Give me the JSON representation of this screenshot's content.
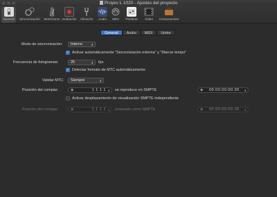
{
  "window": {
    "title": "Proyec L 1020 - Ajustes del proyecto"
  },
  "toolbar": {
    "items": [
      {
        "label": "General",
        "icon": "switch-icon"
      },
      {
        "label": "Sincronización",
        "icon": "gears-icon"
      },
      {
        "label": "Metrónomo",
        "icon": "metronome-icon"
      },
      {
        "label": "Grabación",
        "icon": "record-icon"
      },
      {
        "label": "Afinación",
        "icon": "tuning-fork-icon"
      },
      {
        "label": "Audio",
        "icon": "waveform-icon"
      },
      {
        "label": "MIDI",
        "icon": "midi-icon"
      },
      {
        "label": "Partitura",
        "icon": "score-icon"
      },
      {
        "label": "Vídeo",
        "icon": "film-icon"
      },
      {
        "label": "Componentes",
        "icon": "briefcase-icon"
      }
    ]
  },
  "tabs": [
    "General",
    "Audio",
    "MIDI",
    "Unitor"
  ],
  "form": {
    "sync_mode_label": "Modo de sincronización:",
    "sync_mode_value": "Interno",
    "auto_enable_label": "Activar automáticamente \"Sincronización externa\" y \"Marcar tempo\"",
    "frame_rate_label": "Frecuencia de fotogramas:",
    "frame_rate_value": "25",
    "frame_rate_unit": "fps",
    "detect_mtc_label": "Detectar formato de MTC automáticamente",
    "validate_mtc_label": "Validar MTC:",
    "validate_mtc_value": "Siempre",
    "bar_pos_label_1": "Posición del compás:",
    "bar_pos_value_1": "1  1  1  1",
    "plays_at_smpte_label": "se reproduce en SMPTE",
    "smpte_value_1": "00:00:00:00.00",
    "smpte_offset_label": "Activar desplazamiento de visualización SMPTE independiente",
    "bar_pos_label_2": "Posición del compás:",
    "bar_pos_value_2": "1  1  1  1",
    "shown_as_smpte_label": "mostrado como SMPTE",
    "smpte_value_2": "00:00:00:00.00"
  },
  "colors": {
    "accent": "#3b73c4",
    "background": "#2c2c2c"
  }
}
